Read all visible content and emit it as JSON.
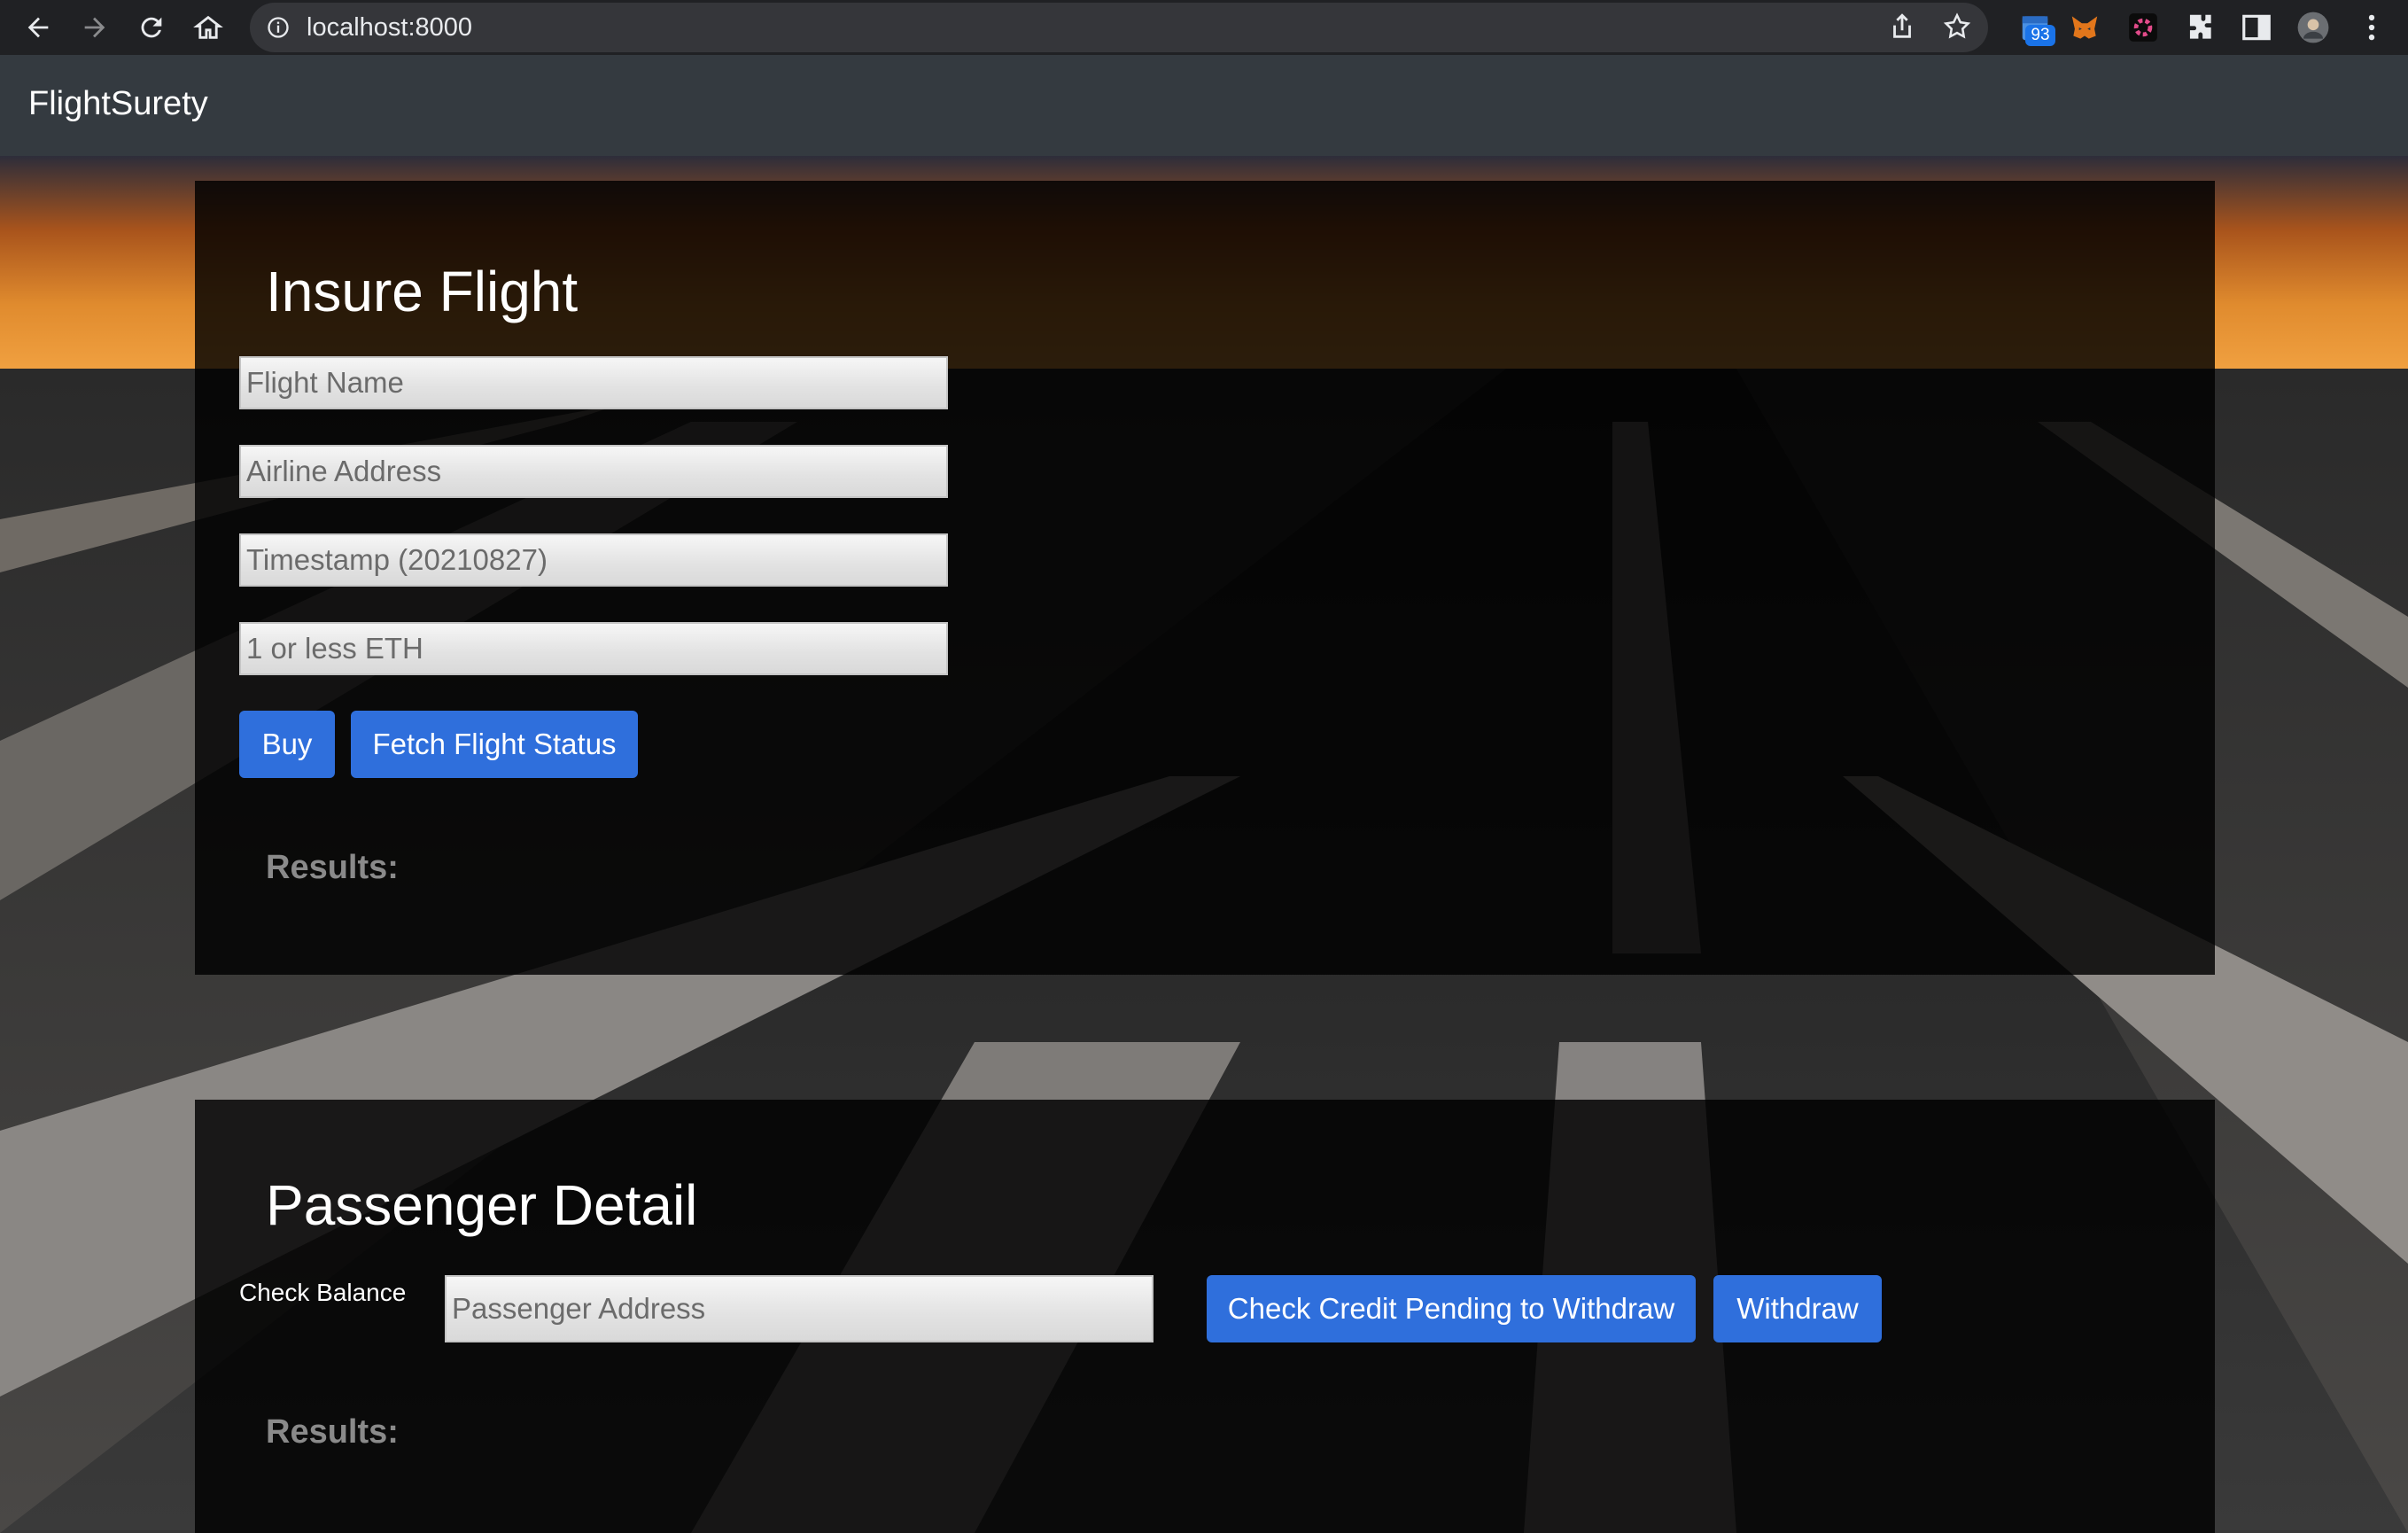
{
  "browser": {
    "url": "localhost:8000",
    "extension_badge_count": "93"
  },
  "navbar": {
    "brand": "FlightSurety"
  },
  "insure_flight": {
    "title": "Insure Flight",
    "flight_name_placeholder": "Flight Name",
    "airline_address_placeholder": "Airline Address",
    "timestamp_placeholder": "Timestamp (20210827)",
    "amount_placeholder": "1 or less ETH",
    "buy_label": "Buy",
    "fetch_status_label": "Fetch Flight Status",
    "results_label": "Results:"
  },
  "passenger_detail": {
    "title": "Passenger Detail",
    "check_balance_label": "Check Balance",
    "passenger_address_placeholder": "Passenger Address",
    "check_credit_label": "Check Credit Pending to Withdraw",
    "withdraw_label": "Withdraw",
    "results_label": "Results:"
  },
  "colors": {
    "button_primary": "#2f6fdc",
    "navbar": "#343a40",
    "chrome": "#202124"
  }
}
